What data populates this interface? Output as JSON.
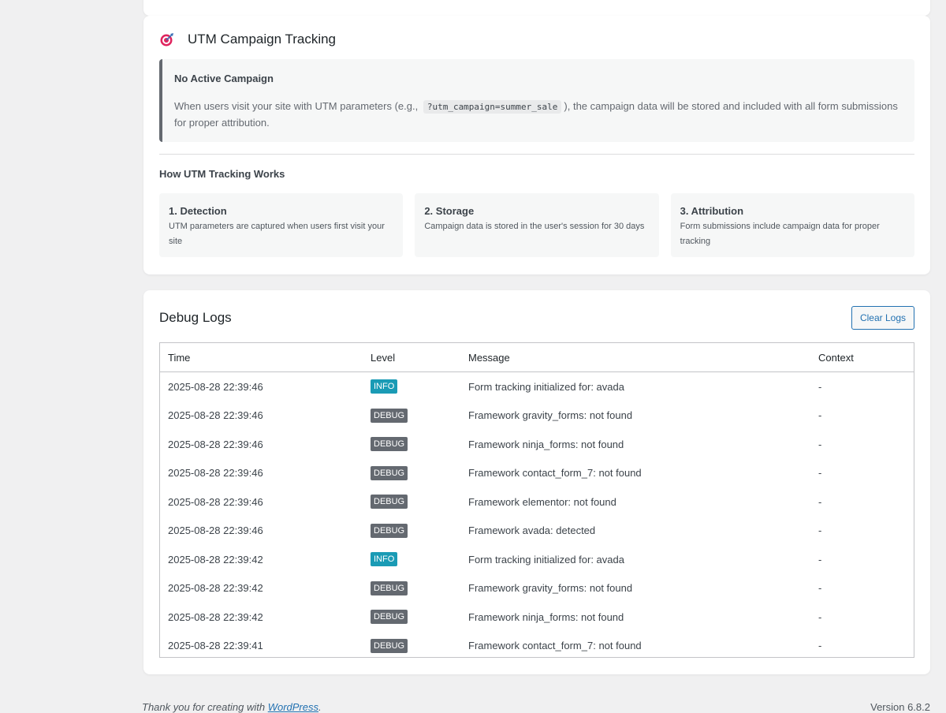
{
  "utm": {
    "title": "UTM Campaign Tracking",
    "notice_title": "No Active Campaign",
    "notice_text_before": "When users visit your site with UTM parameters (e.g.,",
    "notice_code": "?utm_campaign=summer_sale",
    "notice_text_after": "), the campaign data will be stored and included with all form submissions for proper attribution.",
    "how_title": "How UTM Tracking Works",
    "steps": [
      {
        "title": "1. Detection",
        "text": "UTM parameters are captured when users first visit your site"
      },
      {
        "title": "2. Storage",
        "text": "Campaign data is stored in the user's session for 30 days"
      },
      {
        "title": "3. Attribution",
        "text": "Form submissions include campaign data for proper tracking"
      }
    ]
  },
  "debug": {
    "title": "Debug Logs",
    "clear_label": "Clear Logs",
    "columns": [
      "Time",
      "Level",
      "Message",
      "Context"
    ],
    "rows": [
      {
        "time": "2025-08-28 22:39:46",
        "level": "INFO",
        "message": "Form tracking initialized for: avada",
        "context": "-"
      },
      {
        "time": "2025-08-28 22:39:46",
        "level": "DEBUG",
        "message": "Framework gravity_forms: not found",
        "context": "-"
      },
      {
        "time": "2025-08-28 22:39:46",
        "level": "DEBUG",
        "message": "Framework ninja_forms: not found",
        "context": "-"
      },
      {
        "time": "2025-08-28 22:39:46",
        "level": "DEBUG",
        "message": "Framework contact_form_7: not found",
        "context": "-"
      },
      {
        "time": "2025-08-28 22:39:46",
        "level": "DEBUG",
        "message": "Framework elementor: not found",
        "context": "-"
      },
      {
        "time": "2025-08-28 22:39:46",
        "level": "DEBUG",
        "message": "Framework avada: detected",
        "context": "-"
      },
      {
        "time": "2025-08-28 22:39:42",
        "level": "INFO",
        "message": "Form tracking initialized for: avada",
        "context": "-"
      },
      {
        "time": "2025-08-28 22:39:42",
        "level": "DEBUG",
        "message": "Framework gravity_forms: not found",
        "context": "-"
      },
      {
        "time": "2025-08-28 22:39:42",
        "level": "DEBUG",
        "message": "Framework ninja_forms: not found",
        "context": "-"
      },
      {
        "time": "2025-08-28 22:39:41",
        "level": "DEBUG",
        "message": "Framework contact_form_7: not found",
        "context": "-"
      }
    ]
  },
  "footer": {
    "thanks_before": "Thank you for creating with",
    "thanks_link": "WordPress",
    "version": "Version 6.8.2"
  },
  "colors": {
    "info": "#1a9bb5",
    "debug": "#646970",
    "accent": "#2271b1"
  }
}
